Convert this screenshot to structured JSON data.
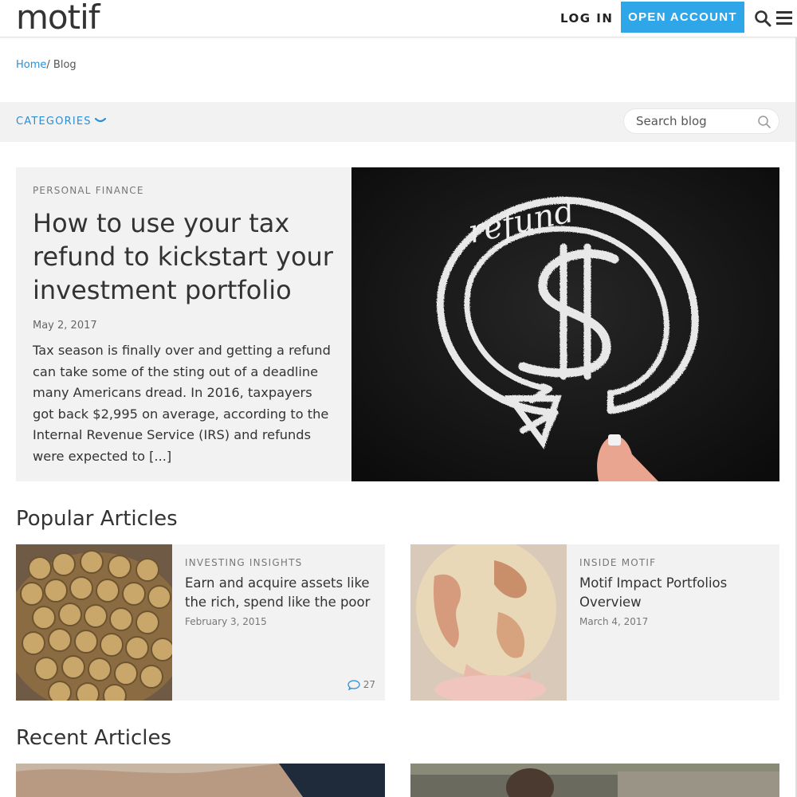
{
  "header": {
    "logo": "motif",
    "login": "LOG IN",
    "open_account": "OPEN ACCOUNT"
  },
  "breadcrumb": {
    "home": "Home",
    "separator": "/",
    "current": "Blog"
  },
  "category_bar": {
    "categories_label": "CATEGORIES",
    "search_placeholder": "Search blog"
  },
  "hero": {
    "category": "PERSONAL FINANCE",
    "title": "How to use your tax refund to kickstart your investment portfolio",
    "date": "May 2, 2017",
    "excerpt": "Tax season is finally over and getting a refund can take some of the sting out of a deadline many Americans dread. In 2016, taxpayers got back $2,995 on average, according to the Internal Revenue Service (IRS) and refunds were expected to [...]",
    "image_word": "refund"
  },
  "popular": {
    "heading": "Popular Articles",
    "cards": [
      {
        "category": "INVESTING INSIGHTS",
        "title": "Earn and acquire assets like the rich, spend like the poor",
        "date": "February 3, 2015",
        "comments": "27",
        "thumb": "gold-coins"
      },
      {
        "category": "INSIDE MOTIF",
        "title": "Motif Impact Portfolios Overview",
        "date": "March 4, 2017",
        "thumb": "globe"
      }
    ]
  },
  "recent": {
    "heading": "Recent Articles"
  },
  "colors": {
    "accent": "#2ea6e8",
    "link": "#2a8fd6",
    "panel": "#f2f2f2"
  }
}
